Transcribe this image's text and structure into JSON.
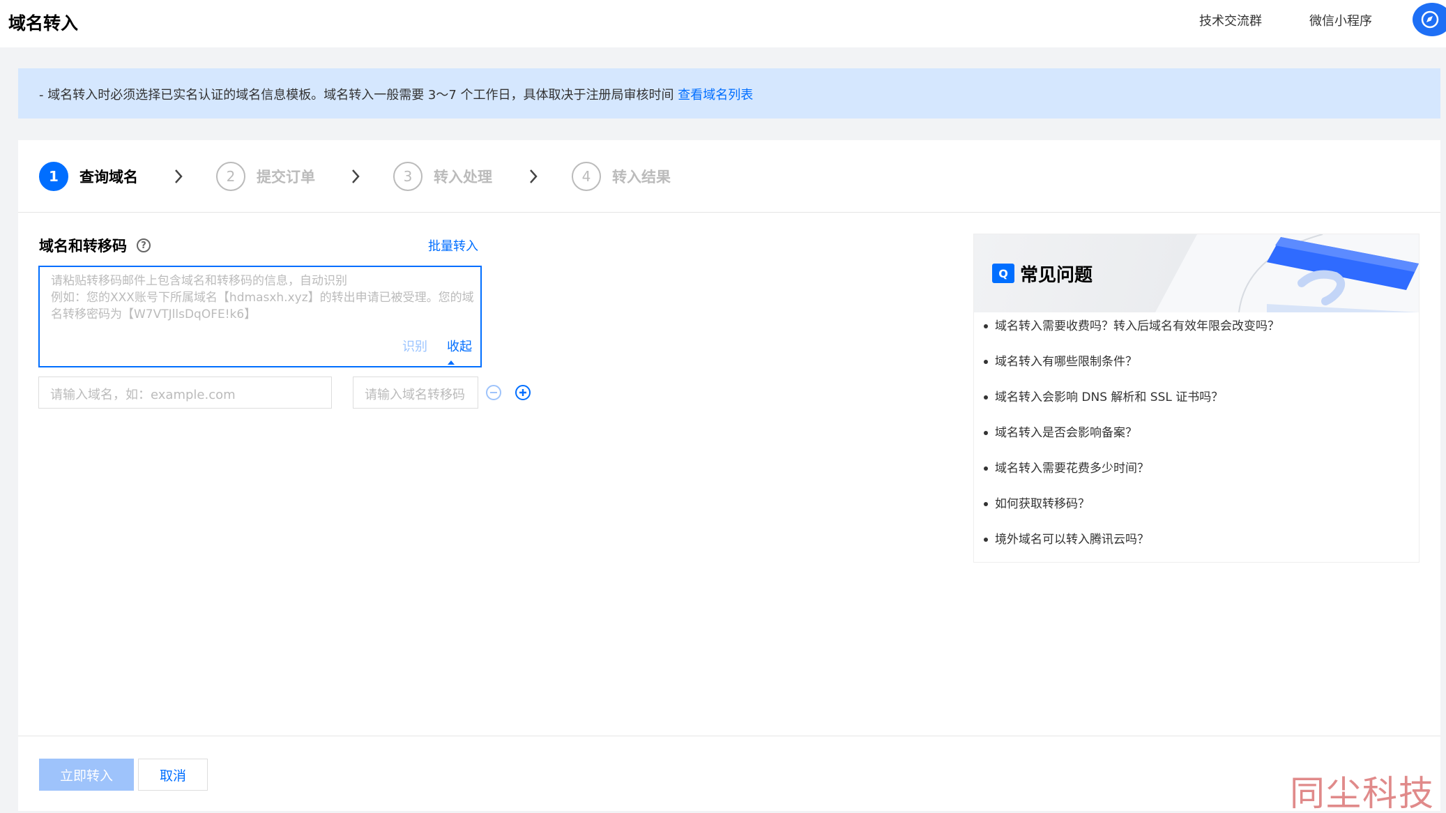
{
  "topbar": {
    "title": "域名转入",
    "links": [
      "技术交流群",
      "微信小程序"
    ],
    "compass_icon": "compass-icon"
  },
  "notice": {
    "text": "- 域名转入时必须选择已实名认证的域名信息模板。域名转入一般需要 3～7 个工作日，具体取决于注册局审核时间 ",
    "link": "查看域名列表"
  },
  "steps": [
    {
      "num": "1",
      "label": "查询域名",
      "active": true
    },
    {
      "num": "2",
      "label": "提交订单",
      "active": false
    },
    {
      "num": "3",
      "label": "转入处理",
      "active": false
    },
    {
      "num": "4",
      "label": "转入结果",
      "active": false
    }
  ],
  "form": {
    "label": "域名和转移码",
    "help": "?",
    "batch_link": "批量转入",
    "parse_placeholder_line1": "请粘贴转移码邮件上包含域名和转移码的信息，自动识别",
    "parse_placeholder_line2": "例如：您的XXX账号下所属域名【hdmasxh.xyz】的转出申请已被受理。您的域名转移密码为【W7VTJllsDqOFE!k6】",
    "identify": "识别",
    "collapse": "收起",
    "domain_placeholder": "请输入域名，如：example.com",
    "code_placeholder": "请输入域名转移码"
  },
  "faq": {
    "icon_letter": "Q",
    "title": "常见问题",
    "items": [
      "域名转入需要收费吗？转入后域名有效年限会改变吗？",
      "域名转入有哪些限制条件？",
      "域名转入会影响 DNS 解析和 SSL 证书吗？",
      "域名转入是否会影响备案？",
      "域名转入需要花费多少时间？",
      "如何获取转移码？",
      "境外域名可以转入腾讯云吗？"
    ]
  },
  "footer": {
    "submit": "立即转入",
    "cancel": "取消"
  },
  "watermark": "同尘科技",
  "colors": {
    "accent": "#006eff",
    "notice_bg": "#d5e7fe",
    "disabled_btn": "#9ec3fb"
  }
}
